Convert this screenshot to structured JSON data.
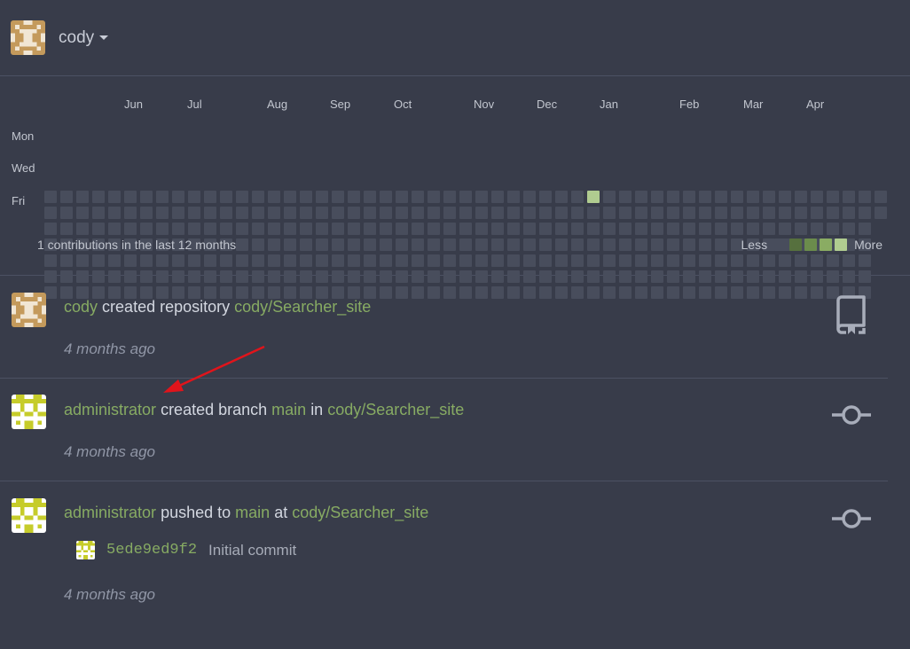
{
  "header": {
    "username": "cody"
  },
  "heatmap": {
    "months": [
      "Jun",
      "Jul",
      "Aug",
      "Sep",
      "Oct",
      "Nov",
      "Dec",
      "Jan",
      "Feb",
      "Mar",
      "Apr"
    ],
    "day_labels": [
      "Mon",
      "Wed",
      "Fri"
    ],
    "summary": "1 contributions in the last 12 months",
    "legend_less": "Less",
    "legend_more": "More",
    "colors": {
      "empty": "#484d5c",
      "level1": "#56703e",
      "level2": "#6b8c4c",
      "level3": "#8aac63",
      "level4": "#b0cc90"
    },
    "active_cell_color": "#b0cc90"
  },
  "feed": [
    {
      "actor": "cody",
      "action": "created repository",
      "repo": "cody/Searcher_site",
      "time": "4 months ago",
      "icon": "repo-icon"
    },
    {
      "actor": "administrator",
      "action": "created branch",
      "branch": "main",
      "preposition": "in",
      "repo": "cody/Searcher_site",
      "time": "4 months ago",
      "icon": "git-commit-icon"
    },
    {
      "actor": "administrator",
      "action": "pushed to",
      "branch": "main",
      "preposition": "at",
      "repo": "cody/Searcher_site",
      "commit_sha": "5ede9ed9f2",
      "commit_message": "Initial commit",
      "time": "4 months ago",
      "icon": "git-commit-icon"
    }
  ],
  "theme": {
    "background": "#383c4a",
    "link_green": "#87ab63",
    "annotation_arrow": "#e0141b"
  }
}
